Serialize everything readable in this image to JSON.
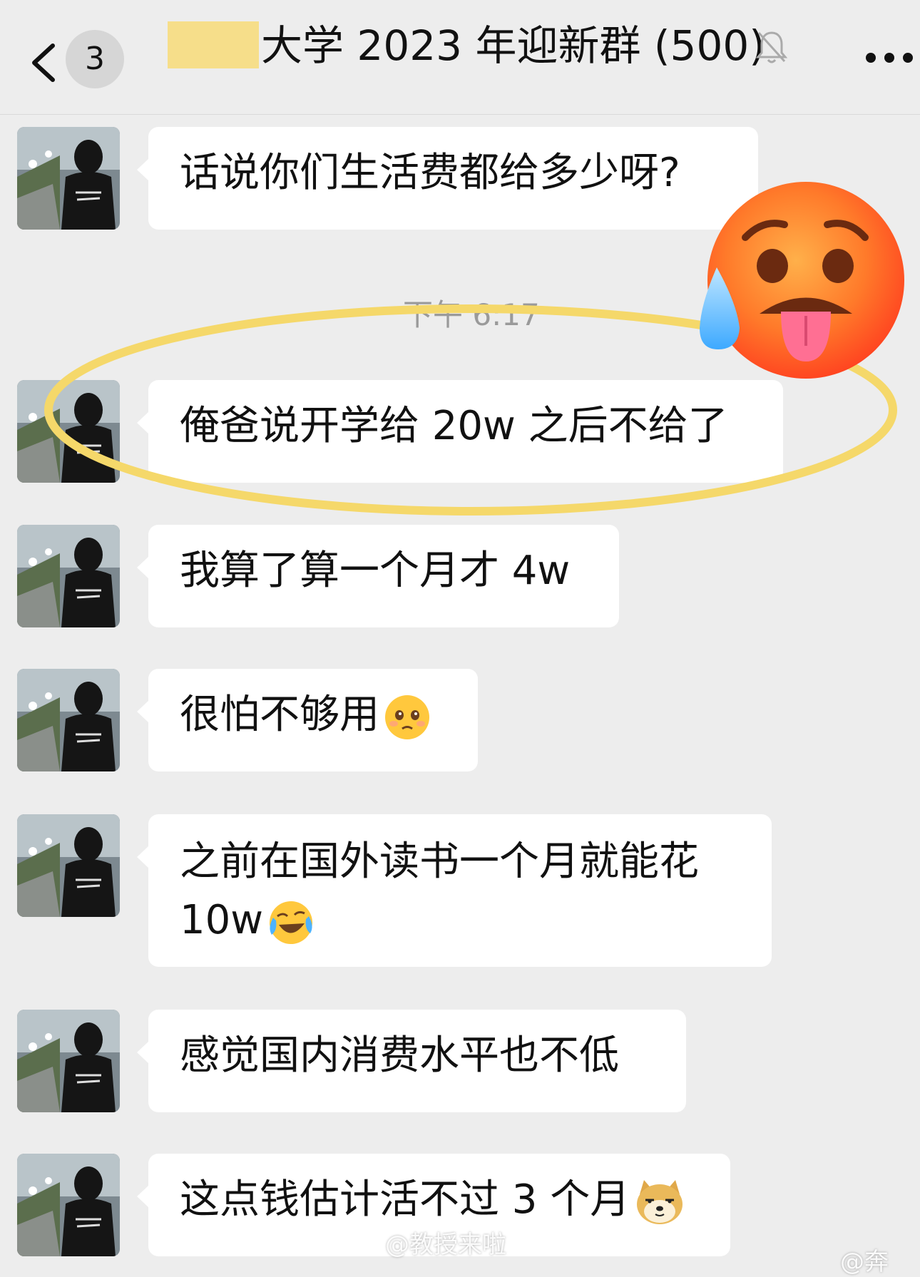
{
  "header": {
    "unread_count": "3",
    "title": "大学 2023 年迎新群 (500)",
    "icons": [
      "chevron-left-icon",
      "bell-muted-icon",
      "more-icon"
    ]
  },
  "timestamp": "下午 6:17",
  "messages": [
    {
      "text": "话说你们生活费都给多少呀?"
    },
    {
      "text": "俺爸说开学给 20w 之后不给了"
    },
    {
      "text": "我算了算一个月才 4w"
    },
    {
      "text": "很怕不够用",
      "emoji": "pleading-face-icon"
    },
    {
      "line1": "之前在国外读书一个月就能花",
      "line2": "10w",
      "emoji": "laughing-crying-face-icon"
    },
    {
      "text": "感觉国内消费水平也不低"
    },
    {
      "text": "这点钱估计活不过 3 个月",
      "emoji": "doge-icon"
    }
  ],
  "overlays": {
    "sticker": "hot-face-emoji-icon",
    "highlight_color": "#f5d86a"
  },
  "watermark": {
    "main": "@教授来啦",
    "corner": "@奔"
  },
  "colors": {
    "background": "#ededed",
    "bubble": "#ffffff",
    "redact": "#f6de8a"
  }
}
